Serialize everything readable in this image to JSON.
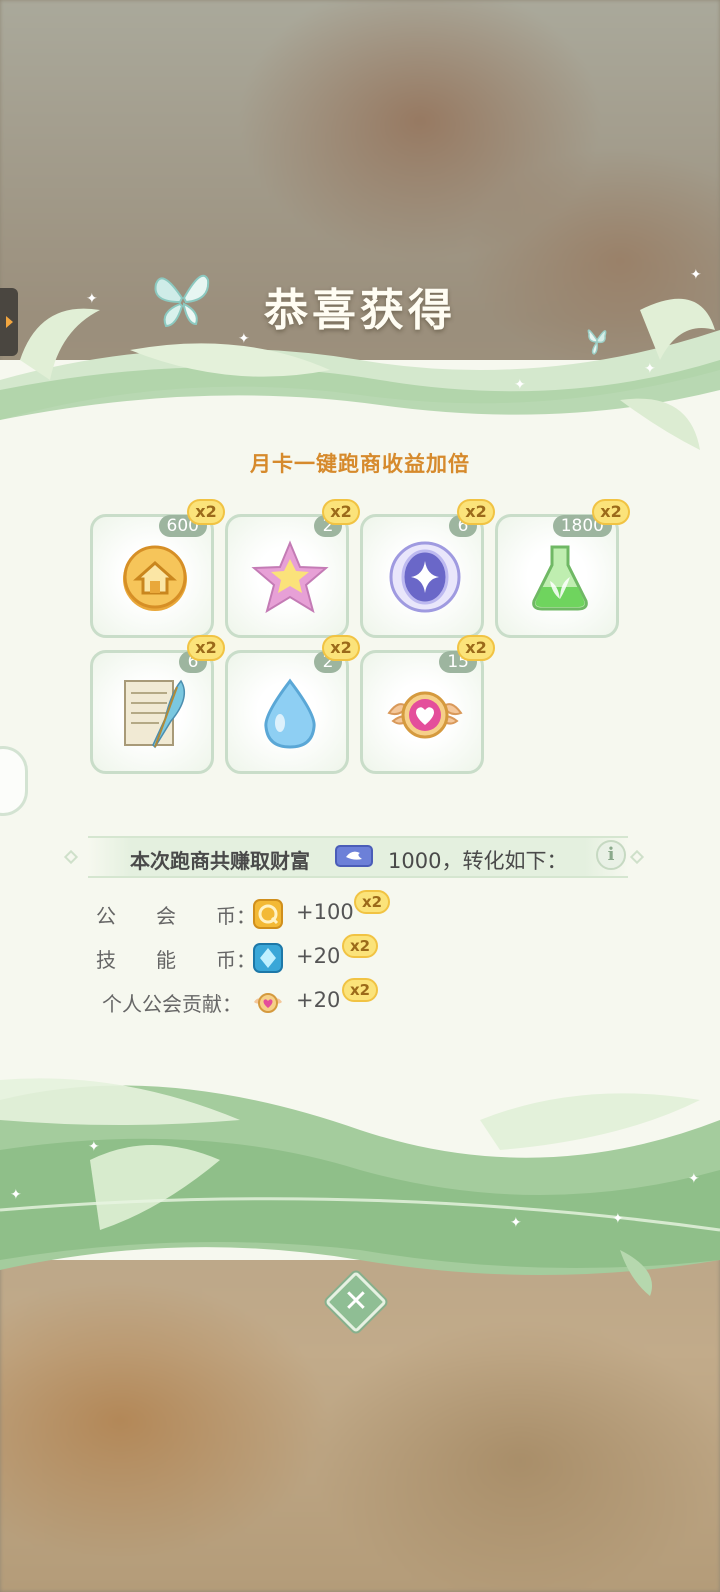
{
  "title": "恭喜获得",
  "subtitle": "月卡一键跑商收益加倍",
  "items": [
    {
      "count": "600",
      "mult": "x2",
      "icon": "gold-coin-house-icon"
    },
    {
      "count": "2",
      "mult": "x2",
      "icon": "pink-star-icon"
    },
    {
      "count": "6",
      "mult": "x2",
      "icon": "purple-sparkle-medal-icon"
    },
    {
      "count": "1800",
      "mult": "x2",
      "icon": "green-potion-flask-icon"
    },
    {
      "count": "6",
      "mult": "x2",
      "icon": "paper-quill-icon"
    },
    {
      "count": "2",
      "mult": "x2",
      "icon": "blue-water-drop-icon"
    },
    {
      "count": "15",
      "mult": "x2",
      "icon": "heart-emblem-icon"
    }
  ],
  "wealth": {
    "prefix": "本次跑商共赚取财富",
    "value": "1000",
    "suffix": "，转化如下：",
    "info_label": "i"
  },
  "rewards": [
    {
      "label": "公　　会　　币：",
      "value": "+100",
      "mult": "x2",
      "icon": "guild-coin-icon"
    },
    {
      "label": "技　　能　　币：",
      "value": "+20",
      "mult": "x2",
      "icon": "skill-coin-icon"
    },
    {
      "label": "个人公会贡献：",
      "value": "+20",
      "mult": "x2",
      "icon": "guild-contribution-icon"
    }
  ],
  "close_label": "✕",
  "colors": {
    "subtitle": "#d68a2c",
    "panel": "#f6f8ef",
    "vine": "#9cc49a",
    "badge_count": "#9db59f",
    "badge_mult": "#fbe37a"
  }
}
